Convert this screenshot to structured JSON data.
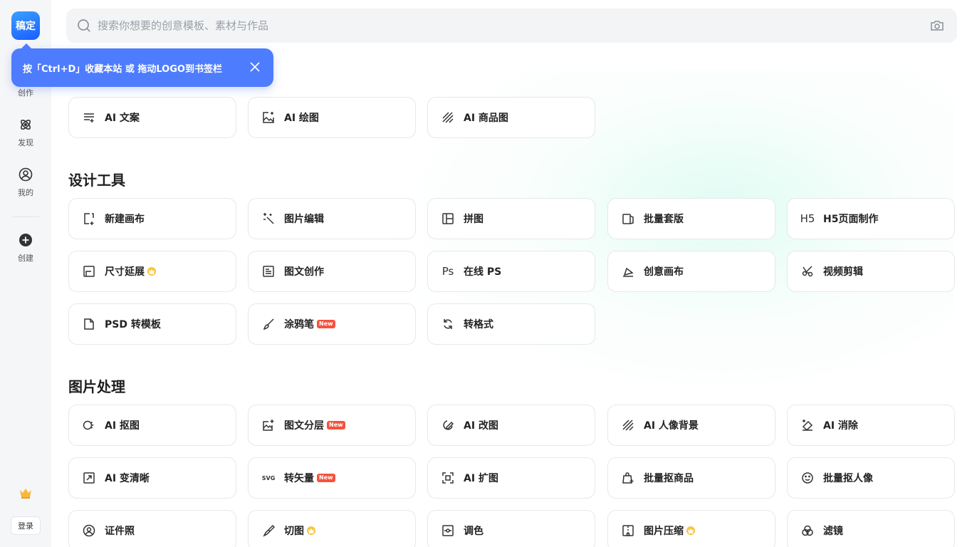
{
  "sidebar": {
    "logo_text": "稿定",
    "items": [
      {
        "label": "创作",
        "icon": "create-icon"
      },
      {
        "label": "发现",
        "icon": "discover-icon"
      },
      {
        "label": "我的",
        "icon": "user-icon"
      },
      {
        "label": "创建",
        "icon": "plus-circle-icon"
      }
    ],
    "crown_icon": "crown-icon",
    "login_label": "登录"
  },
  "search": {
    "placeholder": "搜索你想要的创意模板、素材与作品",
    "icon": "search-icon",
    "camera_icon": "camera-icon"
  },
  "tooltip": {
    "text": "按「Ctrl+D」收藏本站 或 拖动LOGO到书签栏"
  },
  "colors": {
    "accent": "#4d7cfe",
    "new_badge": "#f5533d",
    "vip_badge": "#f8c43a"
  },
  "ai_tools": [
    {
      "label": "AI 文案",
      "icon": "text-lines-icon"
    },
    {
      "label": "AI 绘图",
      "icon": "image-sparkle-icon"
    },
    {
      "label": "AI 商品图",
      "icon": "diagonal-lines-icon"
    }
  ],
  "design_tools": {
    "title": "设计工具",
    "items": [
      {
        "label": "新建画布",
        "icon": "new-canvas-icon",
        "badge": ""
      },
      {
        "label": "图片编辑",
        "icon": "magic-wand-icon",
        "badge": ""
      },
      {
        "label": "拼图",
        "icon": "collage-icon",
        "badge": ""
      },
      {
        "label": "批量套版",
        "icon": "batch-template-icon",
        "badge": ""
      },
      {
        "label": "H5页面制作",
        "icon": "h5-icon",
        "icon_text": "H5",
        "badge": ""
      },
      {
        "label": "尺寸延展",
        "icon": "resize-icon",
        "badge": "vip"
      },
      {
        "label": "图文创作",
        "icon": "doc-icon",
        "badge": ""
      },
      {
        "label": "在线 PS",
        "icon": "ps-icon",
        "icon_text": "Ps",
        "badge": ""
      },
      {
        "label": "创意画布",
        "icon": "creative-canvas-icon",
        "badge": ""
      },
      {
        "label": "视频剪辑",
        "icon": "scissors-icon",
        "badge": ""
      },
      {
        "label": "PSD 转模板",
        "icon": "file-icon",
        "badge": ""
      },
      {
        "label": "涂鸦笔",
        "icon": "brush-icon",
        "badge": "New"
      },
      {
        "label": "转格式",
        "icon": "convert-icon",
        "badge": ""
      }
    ]
  },
  "image_tools": {
    "title": "图片处理",
    "items": [
      {
        "label": "AI 抠图",
        "icon": "cutout-icon",
        "badge": ""
      },
      {
        "label": "图文分层",
        "icon": "layer-icon",
        "badge": "New"
      },
      {
        "label": "AI 改图",
        "icon": "edit-image-icon",
        "badge": ""
      },
      {
        "label": "AI 人像背景",
        "icon": "portrait-bg-icon",
        "badge": ""
      },
      {
        "label": "AI 消除",
        "icon": "eraser-icon",
        "badge": ""
      },
      {
        "label": "AI 变清晰",
        "icon": "expand-arrow-icon",
        "badge": ""
      },
      {
        "label": "转矢量",
        "icon": "svg-icon",
        "icon_text": "SVG",
        "badge": "New"
      },
      {
        "label": "AI 扩图",
        "icon": "extend-image-icon",
        "badge": ""
      },
      {
        "label": "批量抠商品",
        "icon": "bag-icon",
        "badge": ""
      },
      {
        "label": "批量抠人像",
        "icon": "smile-icon",
        "badge": ""
      },
      {
        "label": "证件照",
        "icon": "id-photo-icon",
        "badge": ""
      },
      {
        "label": "切图",
        "icon": "knife-icon",
        "badge": "vip"
      },
      {
        "label": "调色",
        "icon": "color-adjust-icon",
        "badge": ""
      },
      {
        "label": "图片压缩",
        "icon": "compress-icon",
        "badge": "vip"
      },
      {
        "label": "滤镜",
        "icon": "filter-icon",
        "badge": ""
      }
    ]
  },
  "badges": {
    "new_label": "New"
  }
}
